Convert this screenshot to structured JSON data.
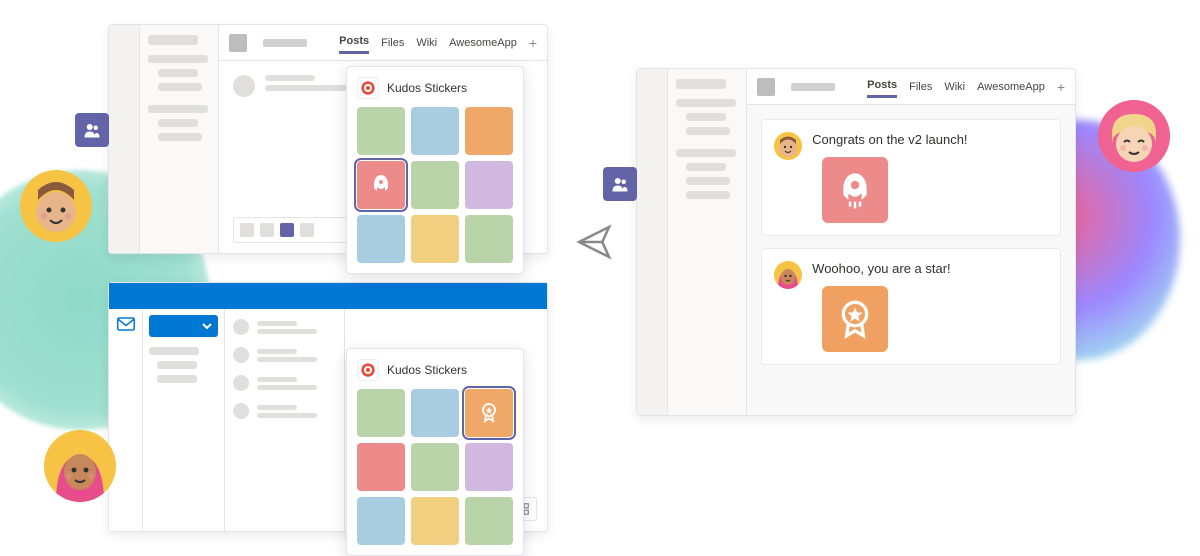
{
  "tabs": [
    "Posts",
    "Files",
    "Wiki",
    "AwesomeApp"
  ],
  "active_tab": "Posts",
  "popup": {
    "title": "Kudos Stickers",
    "stickers_top": [
      {
        "color": "#b8d4a8"
      },
      {
        "color": "#a8cde0"
      },
      {
        "color": "#f0a868"
      },
      {
        "color": "#ed8a8a",
        "icon": "rocket",
        "selected": true
      },
      {
        "color": "#b8d4a8"
      },
      {
        "color": "#d0b8e0"
      },
      {
        "color": "#a8cde0"
      },
      {
        "color": "#f0d080"
      },
      {
        "color": "#b8d4a8"
      }
    ],
    "stickers_bottom": [
      {
        "color": "#b8d4a8"
      },
      {
        "color": "#a8cde0"
      },
      {
        "color": "#f0a868",
        "icon": "star-badge",
        "selected": true
      },
      {
        "color": "#ed8a8a"
      },
      {
        "color": "#b8d4a8"
      },
      {
        "color": "#d0b8e0"
      },
      {
        "color": "#a8cde0"
      },
      {
        "color": "#f0d080"
      },
      {
        "color": "#b8d4a8"
      }
    ]
  },
  "messages": [
    {
      "text": "Congrats on the v2 launch!",
      "sticker_color": "#ed8a8a",
      "sticker_icon": "rocket",
      "avatar_bg": "#f6c344"
    },
    {
      "text": "Woohoo, you are a star!",
      "sticker_color": "#f0a060",
      "sticker_icon": "star-badge",
      "avatar_bg": "#f6c344"
    }
  ],
  "colors": {
    "teams": "#6264a7",
    "outlook": "#0078d4"
  }
}
